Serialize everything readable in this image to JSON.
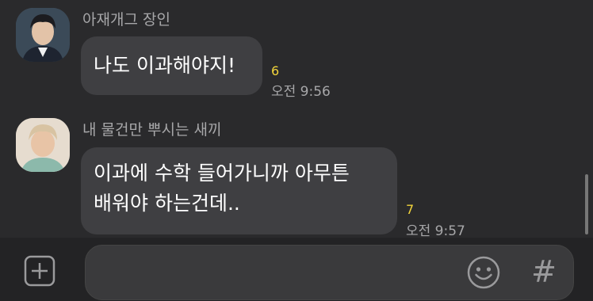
{
  "messages": [
    {
      "sender": "아재개그 장인",
      "text_lines": [
        "나도 이과해야지!"
      ],
      "unread_count": "6",
      "time": "오전 9:56"
    },
    {
      "sender": "내 물건만 뿌시는 새끼",
      "text_lines": [
        "이과에 수학 들어가니까 아무튼",
        "배워야 하는건데.."
      ],
      "unread_count": "7",
      "time": "오전 9:57"
    }
  ],
  "composer": {
    "placeholder": "",
    "hash_symbol": "#"
  },
  "colors": {
    "background": "#2a2a2c",
    "bubble": "#3f3f42",
    "unread": "#f2d43b"
  }
}
